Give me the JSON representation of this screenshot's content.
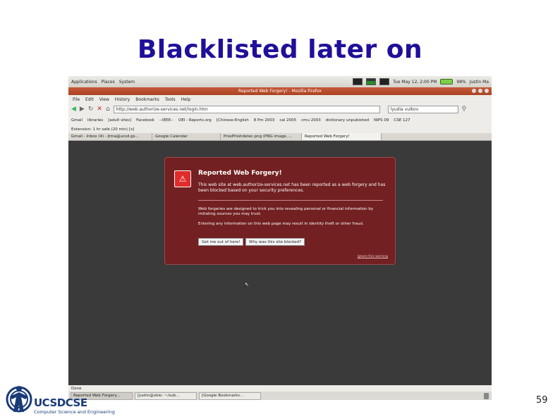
{
  "slide": {
    "title": "Blacklisted later on",
    "page_number": "59",
    "logo": {
      "name": "UCSDCSE",
      "prefix": "UCSD",
      "suffix": "CSE",
      "subtitle": "Computer Science and Engineering"
    }
  },
  "desktop": {
    "menus": [
      "Applications",
      "Places",
      "System"
    ],
    "clock": "Tue May 12, 2:00 PM",
    "battery": "98%",
    "user": "Justin Ma"
  },
  "window": {
    "title": "Reported Web Forgery! - Mozilla Firefox",
    "menubar": [
      "File",
      "Edit",
      "View",
      "History",
      "Bookmarks",
      "Tools",
      "Help"
    ],
    "url": "http://web.authorize-services.net/login.htm",
    "search": "lyudia vulkov",
    "bookmarks": [
      "Gmail",
      "libraries",
      "[adult sites]",
      "Facebook",
      "--IEEE--",
      "OEI - Reports.org",
      "[Chinese-English",
      "8 Pm 2003",
      "cal 2005",
      "cmu 2003",
      "dictionary unpubished",
      "NIPS 09",
      "CSE 127"
    ],
    "status_line": "Extension: 1 hr safe (20 min) [x]",
    "tabs": [
      {
        "label": "Gmail - Inbox (4) - jtma@ucsd.gs...",
        "active": false
      },
      {
        "label": "Google Calendar",
        "active": false
      },
      {
        "label": "ProxPhishdetec.png (PNG image, ...",
        "active": false
      },
      {
        "label": "Reported Web Forgery!",
        "active": true
      }
    ],
    "status_bar": "Done"
  },
  "warning": {
    "heading": "Reported Web Forgery!",
    "description": "This web site at web.authorize-services.net has been reported as a web forgery and has been blocked based on your security preferences.",
    "paragraph1": "Web forgeries are designed to trick you into revealing personal or financial information by imitating sources you may trust.",
    "paragraph2": "Entering any information on this web page may result in identity theft or other fraud.",
    "button_get_out": "Get me out of here!",
    "button_why": "Why was this site blocked?",
    "ignore_link": "Ignore this warning"
  },
  "taskbar": [
    {
      "label": "Reported Web Forgery...",
      "active": true
    },
    {
      "label": "[justin@vbio: ~/sub...",
      "active": false
    },
    {
      "label": "[Google Bookmarks...",
      "active": false
    }
  ],
  "colors": {
    "title": "#1f0f99",
    "warning_bg": "#722021",
    "page_bg": "#3a3a3a"
  }
}
